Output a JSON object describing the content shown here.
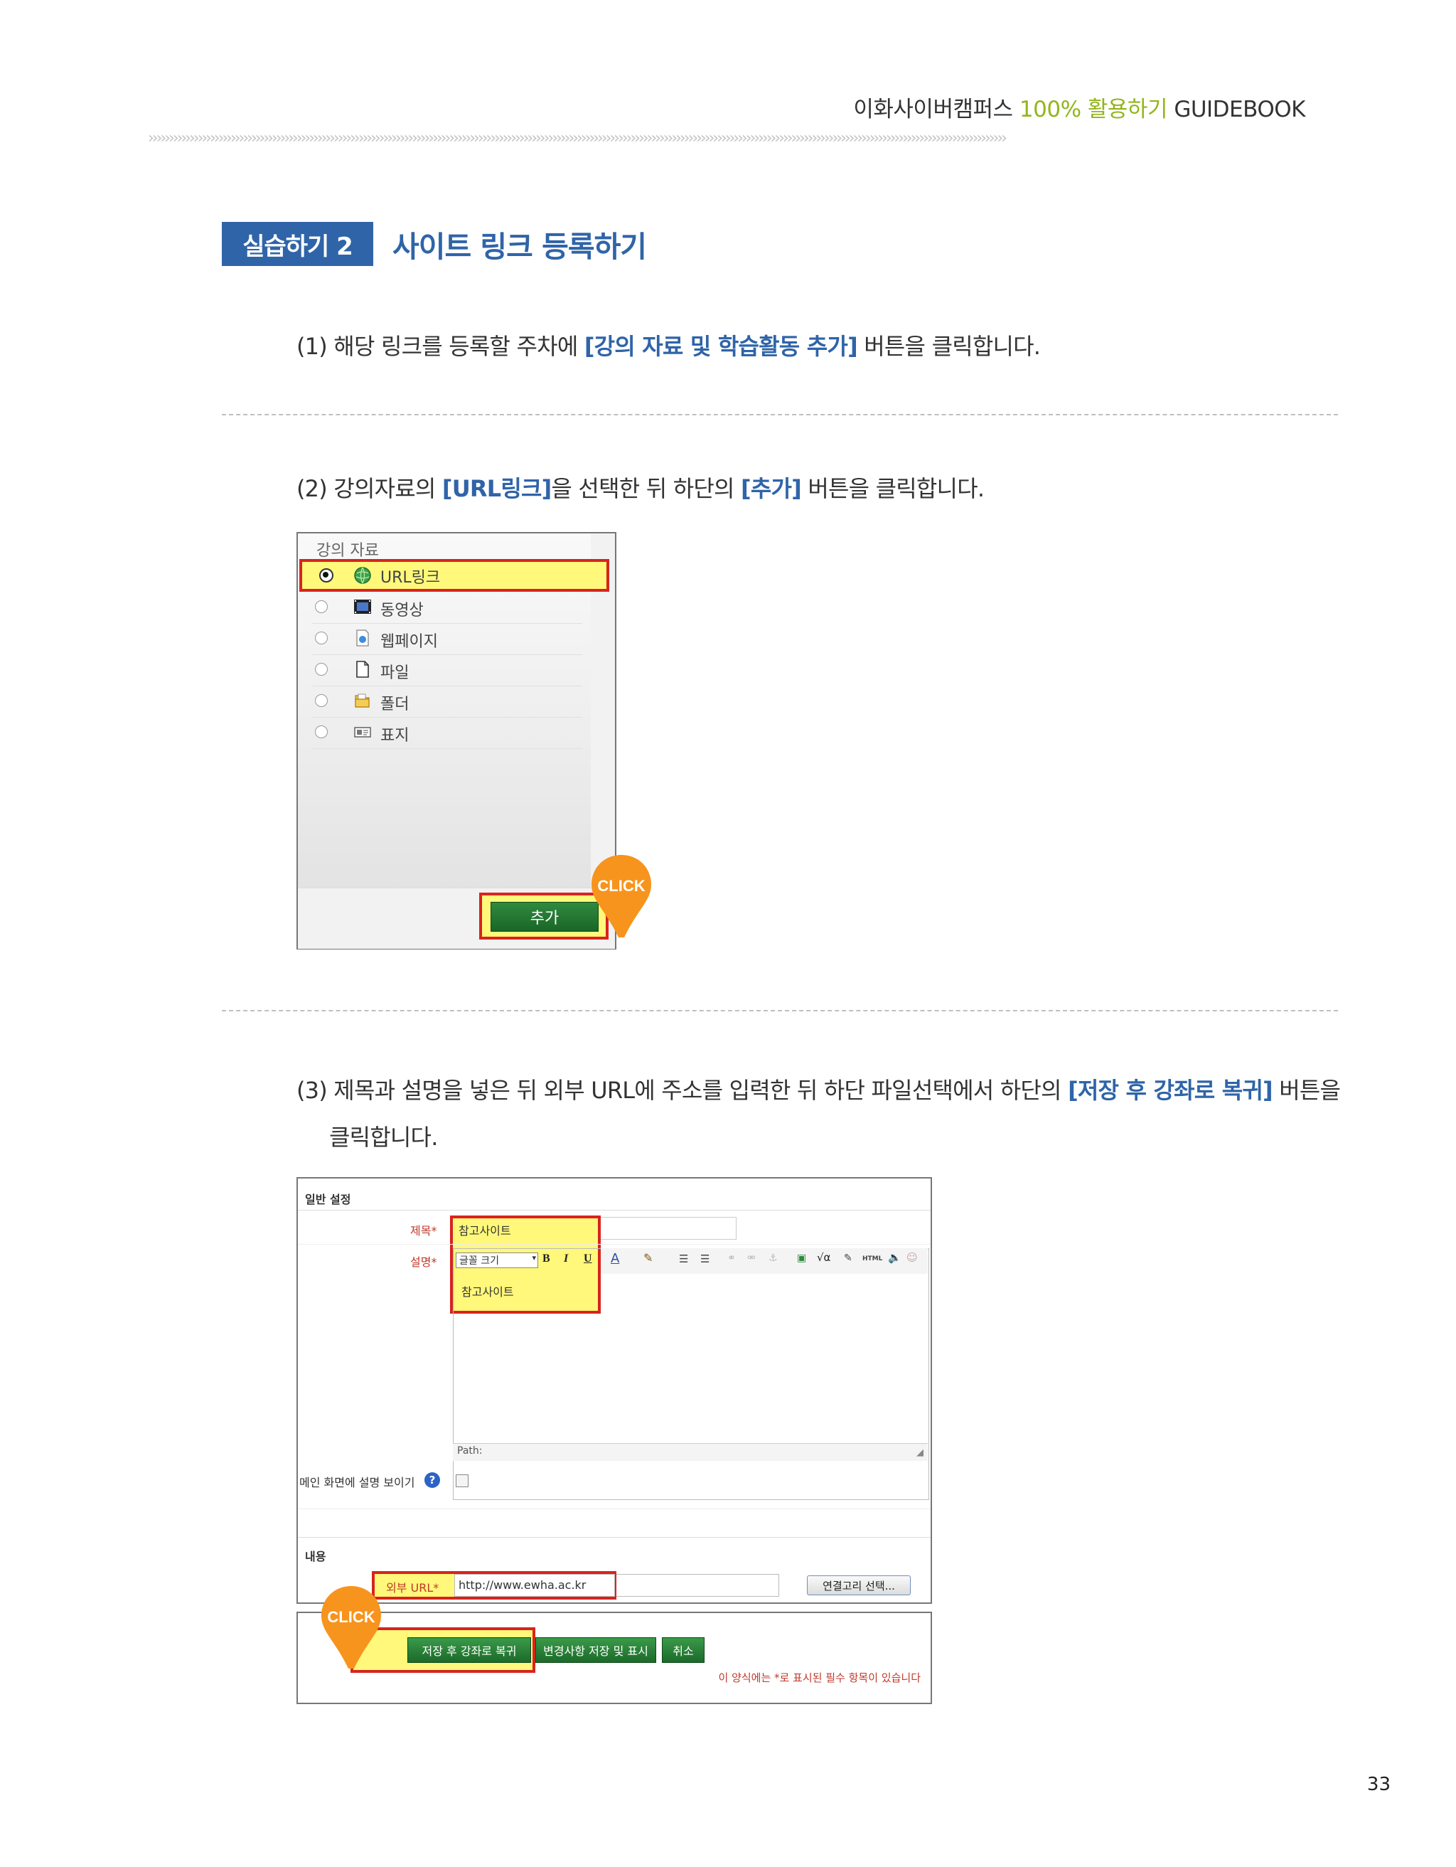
{
  "header": {
    "prefix": "이화사이버캠퍼스",
    "accent": "100% 활용하기",
    "suffix": "GUIDEBOOK",
    "divider": "››››››››››››››››››››››››››››››››››››››››››››››››››››››››››››››››››››››››››››››››››››››››››››››››››››››››››››››››››››››››››››››››››››››››››››››››››››››››››››››››››››››››››››››››››››››››››››››››››››››››››››››››"
  },
  "section": {
    "badge": "실습하기 2",
    "title": "사이트 링크 등록하기"
  },
  "steps": {
    "s1": {
      "pre": "(1) 해당 링크를 등록할 주차에 ",
      "hl": "[강의 자료 및 학습활동 추가]",
      "post": " 버튼을 클릭합니다."
    },
    "s2": {
      "pre": "(2) 강의자료의 ",
      "hl1": "[URL링크]",
      "mid": "을 선택한 뒤 하단의 ",
      "hl2": "[추가]",
      "post": " 버튼을 클릭합니다."
    },
    "s3": {
      "pre": "(3) 제목과 설명을 넣은 뒤 외부 URL에 주소를 입력한 뒤 하단 파일선택에서 하단의 ",
      "hl": "[저장 후 강좌로 복귀]",
      "post": " 버튼을",
      "line2": "클릭합니다."
    }
  },
  "shot1": {
    "title": "강의 자료",
    "items": [
      {
        "label": "URL링크",
        "icon": "globe-icon",
        "selected": true
      },
      {
        "label": "동영상",
        "icon": "film-icon",
        "selected": false
      },
      {
        "label": "웹페이지",
        "icon": "webpage-icon",
        "selected": false
      },
      {
        "label": "파일",
        "icon": "file-icon",
        "selected": false
      },
      {
        "label": "폴더",
        "icon": "folder-icon",
        "selected": false
      },
      {
        "label": "표지",
        "icon": "label-icon",
        "selected": false
      }
    ],
    "add_button": "추가",
    "click": "CLICK"
  },
  "shot2": {
    "general_header": "일반 설정",
    "title_label": "제목*",
    "title_value": "참고사이트",
    "desc_label": "설명*",
    "font_size": "글꼴 크기",
    "desc_value": "참고사이트",
    "path": "Path:",
    "show_desc": "메인 화면에 설명 보이기",
    "content_header": "내용",
    "url_label": "외부 URL*",
    "url_value": "http://www.ewha.ac.kr",
    "link_select": "연결고리 선택...",
    "save_return": "저장 후 강좌로 복귀",
    "save_show": "변경사항 저장 및 표시",
    "cancel": "취소",
    "required_note": "이 양식에는 *로 표시된 필수 항목이 있습니다",
    "click": "CLICK"
  },
  "page_number": "33",
  "colors": {
    "accent_blue": "#2f64a8",
    "accent_green": "#93b51c",
    "highlight": "#fff87a",
    "red_border": "#d8231e",
    "click_orange": "#f7941d"
  }
}
